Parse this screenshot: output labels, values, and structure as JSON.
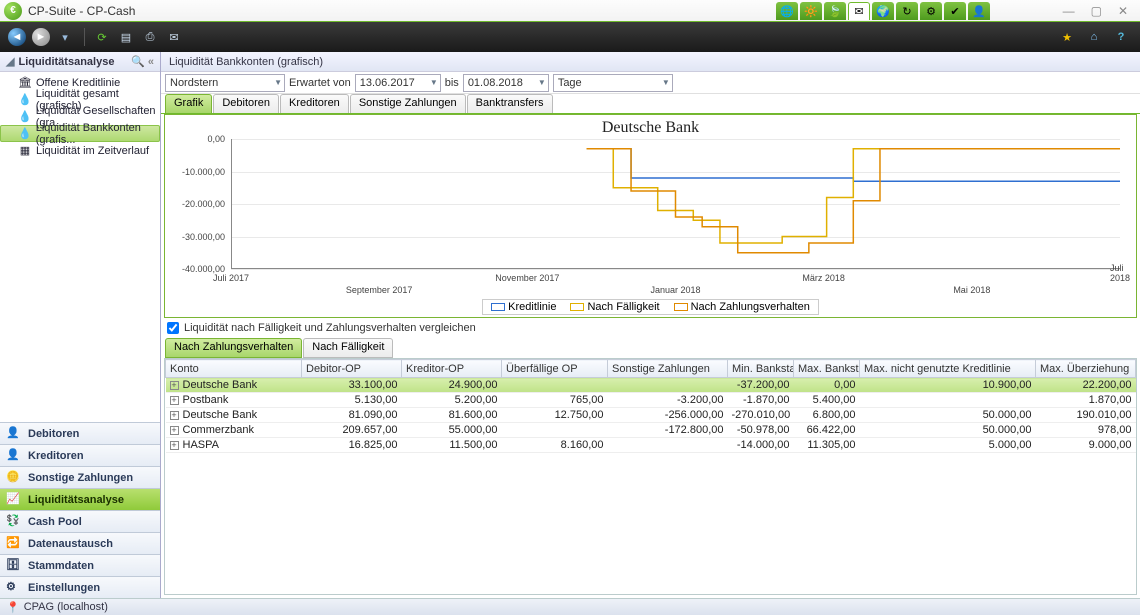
{
  "window": {
    "title": "CP-Suite - CP-Cash"
  },
  "sidebar": {
    "header": "Liquiditätsanalyse",
    "items": [
      {
        "label": "Offene Kreditlinie",
        "icon": "bank"
      },
      {
        "label": "Liquidität gesamt (grafisch)",
        "icon": "drop"
      },
      {
        "label": "Liquidität Gesellschaften (gra...",
        "icon": "drop"
      },
      {
        "label": "Liquidität Bankkonten (grafis...",
        "icon": "drop",
        "selected": true
      },
      {
        "label": "Liquidität im Zeitverlauf",
        "icon": "grid"
      }
    ]
  },
  "nav": [
    {
      "label": "Debitoren",
      "icon": "user"
    },
    {
      "label": "Kreditoren",
      "icon": "user"
    },
    {
      "label": "Sonstige Zahlungen",
      "icon": "coins"
    },
    {
      "label": "Liquiditätsanalyse",
      "icon": "chart",
      "active": true
    },
    {
      "label": "Cash Pool",
      "icon": "pool"
    },
    {
      "label": "Datenaustausch",
      "icon": "exchange"
    },
    {
      "label": "Stammdaten",
      "icon": "db"
    },
    {
      "label": "Einstellungen",
      "icon": "gear"
    }
  ],
  "crumb": "Liquidität Bankkonten (grafisch)",
  "filters": {
    "company": "Nordstern",
    "expected_lbl": "Erwartet  von",
    "date_from": "13.06.2017",
    "to_lbl": "bis",
    "date_to": "01.08.2018",
    "granularity": "Tage"
  },
  "tabs": [
    {
      "label": "Grafik",
      "active": true
    },
    {
      "label": "Debitoren"
    },
    {
      "label": "Kreditoren"
    },
    {
      "label": "Sonstige Zahlungen"
    },
    {
      "label": "Banktransfers"
    }
  ],
  "chart_data": {
    "type": "line",
    "title": "Deutsche Bank",
    "ylabel": "",
    "ylim": [
      -40000,
      0
    ],
    "yticks": [
      0,
      -10000,
      -20000,
      -30000,
      -40000
    ],
    "ytick_labels": [
      "0,00",
      "-10.000,00",
      "-20.000,00",
      "-30.000,00",
      "-40.000,00"
    ],
    "x_range_months": [
      "Juli 2017",
      "September 2017",
      "November 2017",
      "Januar 2018",
      "März 2018",
      "Mai 2018",
      "Juli 2018"
    ],
    "series": [
      {
        "name": "Kreditlinie",
        "color": "#2f6fd0",
        "points": [
          [
            0.4,
            -3000
          ],
          [
            0.45,
            -3000
          ],
          [
            0.45,
            -12000
          ],
          [
            0.7,
            -12000
          ],
          [
            0.7,
            -13000
          ],
          [
            1.0,
            -13000
          ]
        ]
      },
      {
        "name": "Nach Fälligkeit",
        "color": "#e0b000",
        "points": [
          [
            0.4,
            -3000
          ],
          [
            0.43,
            -3000
          ],
          [
            0.43,
            -15000
          ],
          [
            0.48,
            -15000
          ],
          [
            0.48,
            -22000
          ],
          [
            0.52,
            -22000
          ],
          [
            0.52,
            -25000
          ],
          [
            0.55,
            -25000
          ],
          [
            0.55,
            -32000
          ],
          [
            0.62,
            -32000
          ],
          [
            0.62,
            -30000
          ],
          [
            0.67,
            -30000
          ],
          [
            0.67,
            -18000
          ],
          [
            0.7,
            -18000
          ],
          [
            0.7,
            -3000
          ],
          [
            1.0,
            -3000
          ]
        ]
      },
      {
        "name": "Nach Zahlungsverhalten",
        "color": "#e08a00",
        "points": [
          [
            0.4,
            -3000
          ],
          [
            0.45,
            -3000
          ],
          [
            0.45,
            -16000
          ],
          [
            0.5,
            -16000
          ],
          [
            0.5,
            -24000
          ],
          [
            0.53,
            -24000
          ],
          [
            0.53,
            -27000
          ],
          [
            0.57,
            -27000
          ],
          [
            0.57,
            -35000
          ],
          [
            0.65,
            -35000
          ],
          [
            0.65,
            -32000
          ],
          [
            0.7,
            -32000
          ],
          [
            0.7,
            -19000
          ],
          [
            0.73,
            -19000
          ],
          [
            0.73,
            -3000
          ],
          [
            1.0,
            -3000
          ]
        ]
      }
    ]
  },
  "checkbox_label": "Liquidität nach Fälligkeit und Zahlungsverhalten vergleichen",
  "checkbox_checked": true,
  "subtabs": [
    {
      "label": "Nach Zahlungsverhalten",
      "active": true
    },
    {
      "label": "Nach Fälligkeit"
    }
  ],
  "table": {
    "columns": [
      "Konto",
      "Debitor-OP",
      "Kreditor-OP",
      "Überfällige OP",
      "Sonstige Zahlungen",
      "Min. Banksta...",
      "Max. Bankst...",
      "Max. nicht genutzte Kreditlinie",
      "Max. Überziehung"
    ],
    "rows": [
      {
        "sel": true,
        "cells": [
          "Deutsche Bank",
          "33.100,00",
          "24.900,00",
          "",
          "",
          "-37.200,00",
          "0,00",
          "10.900,00",
          "22.200,00"
        ]
      },
      {
        "cells": [
          "Postbank",
          "5.130,00",
          "5.200,00",
          "765,00",
          "-3.200,00",
          "-1.870,00",
          "5.400,00",
          "",
          "1.870,00"
        ]
      },
      {
        "cells": [
          "Deutsche Bank",
          "81.090,00",
          "81.600,00",
          "12.750,00",
          "-256.000,00",
          "-270.010,00",
          "6.800,00",
          "50.000,00",
          "190.010,00"
        ]
      },
      {
        "cells": [
          "Commerzbank",
          "209.657,00",
          "55.000,00",
          "",
          "-172.800,00",
          "-50.978,00",
          "66.422,00",
          "50.000,00",
          "978,00"
        ]
      },
      {
        "cells": [
          "HASPA",
          "16.825,00",
          "11.500,00",
          "8.160,00",
          "",
          "-14.000,00",
          "11.305,00",
          "5.000,00",
          "9.000,00"
        ]
      }
    ]
  },
  "status": "CPAG (localhost)"
}
